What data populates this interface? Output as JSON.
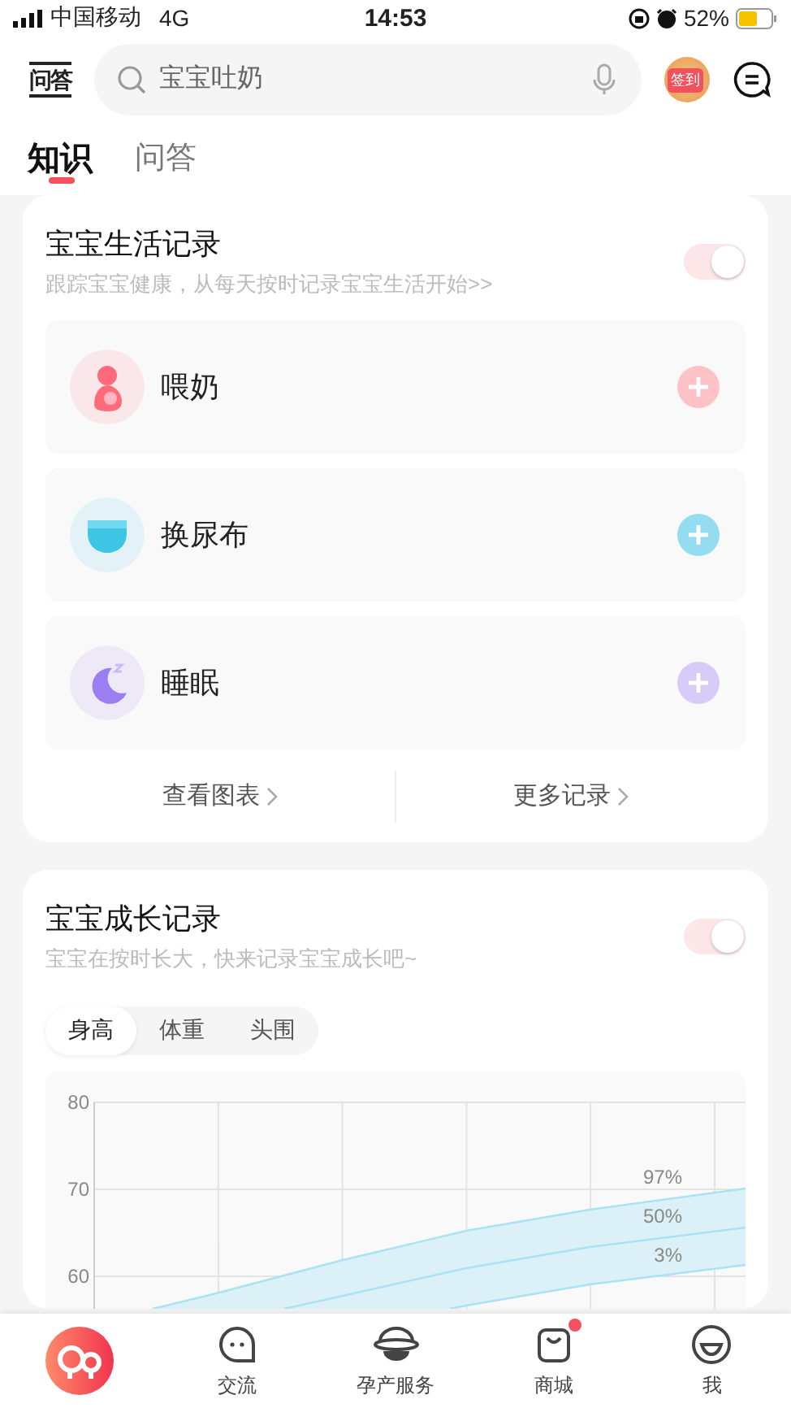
{
  "status_bar": {
    "carrier": "中国移动",
    "network": "4G",
    "time": "14:53",
    "battery": "52%"
  },
  "header": {
    "logo": "问答",
    "search": {
      "placeholder": "宝宝吐奶"
    },
    "sign_in_badge": "签到"
  },
  "tabs": [
    {
      "label": "知识",
      "selected": true
    },
    {
      "label": "问答",
      "selected": false
    }
  ],
  "life_record": {
    "title": "宝宝生活记录",
    "subtitle": "跟踪宝宝健康，从每天按时记录宝宝生活开始>>",
    "on": true,
    "items": [
      {
        "kind": "feeding",
        "label": "喂奶",
        "color": "#ffc2c7"
      },
      {
        "kind": "diaper",
        "label": "换尿布",
        "color": "#94ddf0"
      },
      {
        "kind": "sleep",
        "label": "睡眠",
        "color": "#d8cbf8"
      }
    ],
    "links": [
      "查看图表",
      "更多记录"
    ]
  },
  "growth_record": {
    "title": "宝宝成长记录",
    "subtitle": "宝宝在按时长大，快来记录宝宝成长吧~",
    "on": true,
    "segments": [
      {
        "label": "身高",
        "selected": true
      },
      {
        "label": "体重",
        "selected": false
      },
      {
        "label": "头围",
        "selected": false
      }
    ],
    "growth_chart": {
      "y_ticks": [
        "80",
        "70",
        "60"
      ],
      "curve_labels": [
        "97%",
        "50%",
        "3%"
      ]
    }
  },
  "bottom_nav": [
    {
      "kind": "logo",
      "selected": true
    },
    {
      "kind": "chat",
      "label": "交流",
      "selected": false
    },
    {
      "kind": "planet",
      "label": "孕产服务",
      "selected": false
    },
    {
      "kind": "bag",
      "label": "商城",
      "selected": false,
      "dot": true
    },
    {
      "kind": "face",
      "label": "我",
      "selected": false
    }
  ]
}
